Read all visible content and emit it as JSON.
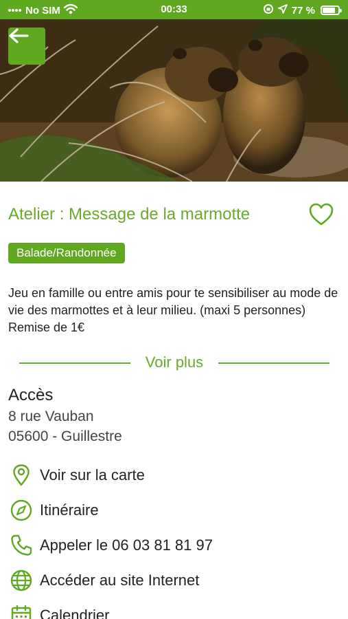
{
  "status_bar": {
    "carrier": "No SIM",
    "time": "00:33",
    "battery": "77 %",
    "battery_level": 0.77
  },
  "colors": {
    "brand_green": "#5fa81f",
    "title_green": "#6aaa2a"
  },
  "header": {
    "back_icon": "arrow-left-icon"
  },
  "event": {
    "title": "Atelier : Message de la marmotte",
    "favorite_icon": "heart-outline-icon",
    "category": "Balade/Randonnée",
    "description": "Jeu en famille ou entre amis pour te sensibiliser au mode de vie des marmottes et à leur milieu.  (maxi 5 personnes) Remise de 1€",
    "more_label": "Voir plus"
  },
  "access": {
    "title": "Accès",
    "address_line1": "8 rue Vauban",
    "address_line2": "05600 - Guillestre"
  },
  "actions": [
    {
      "label": "Voir sur la carte",
      "icon": "map-pin-icon"
    },
    {
      "label": "Itinéraire",
      "icon": "compass-icon"
    },
    {
      "label": "Appeler le 06 03 81 81 97",
      "icon": "phone-icon"
    },
    {
      "label": "Accéder au site Internet",
      "icon": "globe-icon"
    },
    {
      "label": "Calendrier",
      "icon": "calendar-icon"
    }
  ]
}
